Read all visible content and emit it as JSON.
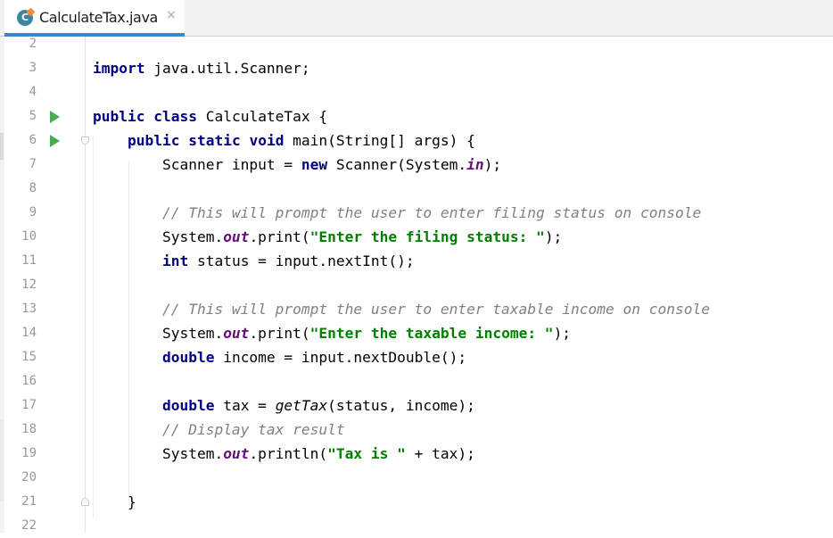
{
  "tab": {
    "title": "CalculateTax.java",
    "icon": "java-class-icon",
    "close": "×"
  },
  "lines": [
    {
      "n": "2"
    },
    {
      "n": "3",
      "tokens": [
        {
          "t": "import",
          "c": "kw"
        },
        {
          "t": " java.util.Scanner;"
        }
      ]
    },
    {
      "n": "4"
    },
    {
      "n": "5",
      "run": true,
      "tokens": [
        {
          "t": "public",
          "c": "kw"
        },
        {
          "t": " "
        },
        {
          "t": "class",
          "c": "kw"
        },
        {
          "t": " CalculateTax {"
        }
      ]
    },
    {
      "n": "6",
      "run": true,
      "fold": "open",
      "tokens": [
        {
          "t": "    "
        },
        {
          "t": "public",
          "c": "kw"
        },
        {
          "t": " "
        },
        {
          "t": "static",
          "c": "kw"
        },
        {
          "t": " "
        },
        {
          "t": "void",
          "c": "kw"
        },
        {
          "t": " main(String[] args) {"
        }
      ]
    },
    {
      "n": "7",
      "tokens": [
        {
          "t": "        Scanner input = "
        },
        {
          "t": "new",
          "c": "kw"
        },
        {
          "t": " Scanner(System."
        },
        {
          "t": "in",
          "c": "fld"
        },
        {
          "t": ");"
        }
      ]
    },
    {
      "n": "8"
    },
    {
      "n": "9",
      "tokens": [
        {
          "t": "        "
        },
        {
          "t": "// This will prompt the user to enter filing status on console",
          "c": "cmt"
        }
      ]
    },
    {
      "n": "10",
      "tokens": [
        {
          "t": "        System."
        },
        {
          "t": "out",
          "c": "fld"
        },
        {
          "t": ".print("
        },
        {
          "t": "\"Enter the filing status: \"",
          "c": "str"
        },
        {
          "t": ");"
        }
      ]
    },
    {
      "n": "11",
      "tokens": [
        {
          "t": "        "
        },
        {
          "t": "int",
          "c": "kw"
        },
        {
          "t": " status = input.nextInt();"
        }
      ]
    },
    {
      "n": "12"
    },
    {
      "n": "13",
      "tokens": [
        {
          "t": "        "
        },
        {
          "t": "// This will prompt the user to enter taxable income on console",
          "c": "cmt"
        }
      ]
    },
    {
      "n": "14",
      "tokens": [
        {
          "t": "        System."
        },
        {
          "t": "out",
          "c": "fld"
        },
        {
          "t": ".print("
        },
        {
          "t": "\"Enter the taxable income: \"",
          "c": "str"
        },
        {
          "t": ");"
        }
      ]
    },
    {
      "n": "15",
      "tokens": [
        {
          "t": "        "
        },
        {
          "t": "double",
          "c": "kw"
        },
        {
          "t": " income = input.nextDouble();"
        }
      ]
    },
    {
      "n": "16"
    },
    {
      "n": "17",
      "tokens": [
        {
          "t": "        "
        },
        {
          "t": "double",
          "c": "kw"
        },
        {
          "t": " tax = "
        },
        {
          "t": "getTax",
          "c": "sm"
        },
        {
          "t": "(status, income);"
        }
      ]
    },
    {
      "n": "18",
      "tokens": [
        {
          "t": "        "
        },
        {
          "t": "// Display tax result",
          "c": "cmt"
        }
      ]
    },
    {
      "n": "19",
      "tokens": [
        {
          "t": "        System."
        },
        {
          "t": "out",
          "c": "fld"
        },
        {
          "t": ".println("
        },
        {
          "t": "\"Tax is \"",
          "c": "str"
        },
        {
          "t": " + tax);"
        }
      ]
    },
    {
      "n": "20"
    },
    {
      "n": "21",
      "fold": "close",
      "tokens": [
        {
          "t": "    }"
        }
      ]
    },
    {
      "n": "22"
    }
  ],
  "colors": {
    "keyword": "#000080",
    "string": "#008000",
    "comment": "#808080",
    "field": "#660e7a",
    "run": "#4daa52",
    "tab_underline": "#4083c9"
  }
}
